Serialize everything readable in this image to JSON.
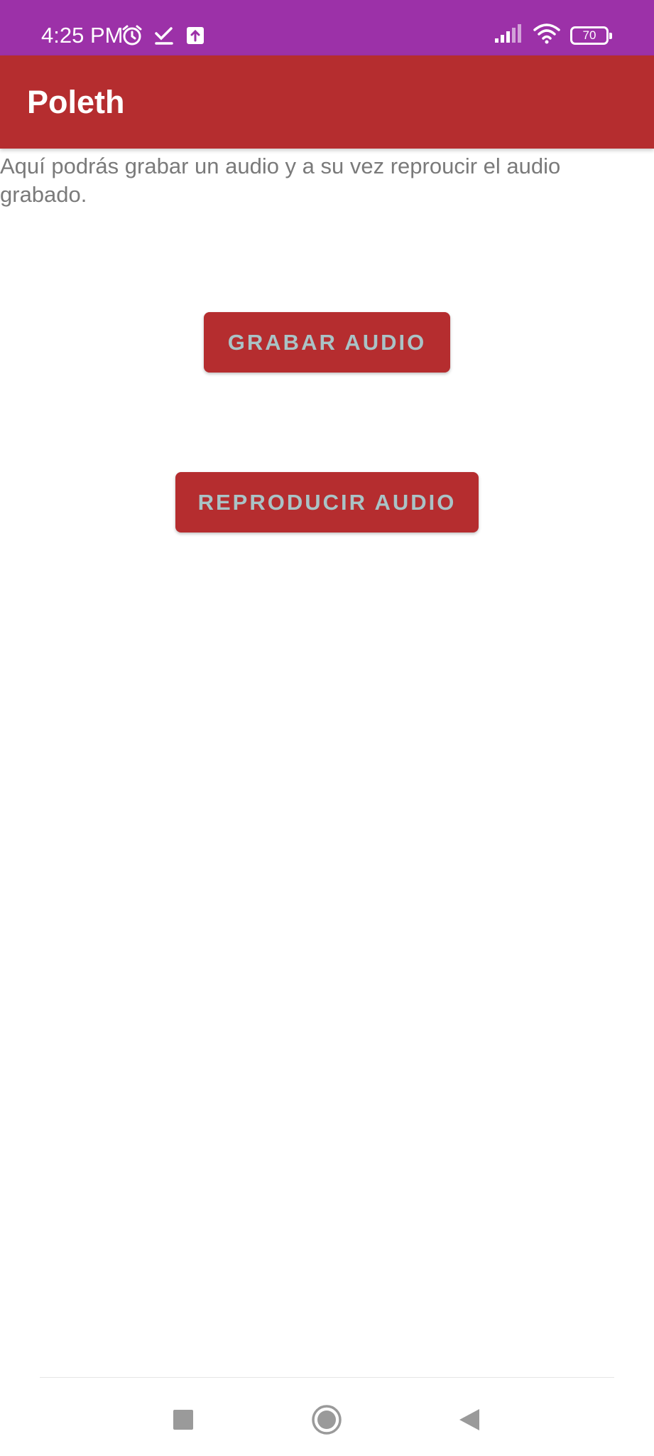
{
  "status_bar": {
    "time": "4:25 PM",
    "battery_level": "70",
    "icons": [
      "alarm-icon",
      "check-icon",
      "upload-icon",
      "signal-icon",
      "wifi-icon",
      "battery-icon"
    ]
  },
  "app_bar": {
    "title": "Poleth"
  },
  "main": {
    "description": "Aquí podrás grabar un audio y a su vez reproucir el audio grabado.",
    "record_button_label": "GRABAR AUDIO",
    "play_button_label": "REPRODUCIR AUDIO"
  },
  "navigation": {
    "items": [
      "recents-icon",
      "home-icon",
      "back-icon"
    ]
  },
  "colors": {
    "status_bar": "#9c31a8",
    "primary": "#b52d2f",
    "button_text": "#a9c3c6",
    "body_text": "#7a7a7a"
  }
}
